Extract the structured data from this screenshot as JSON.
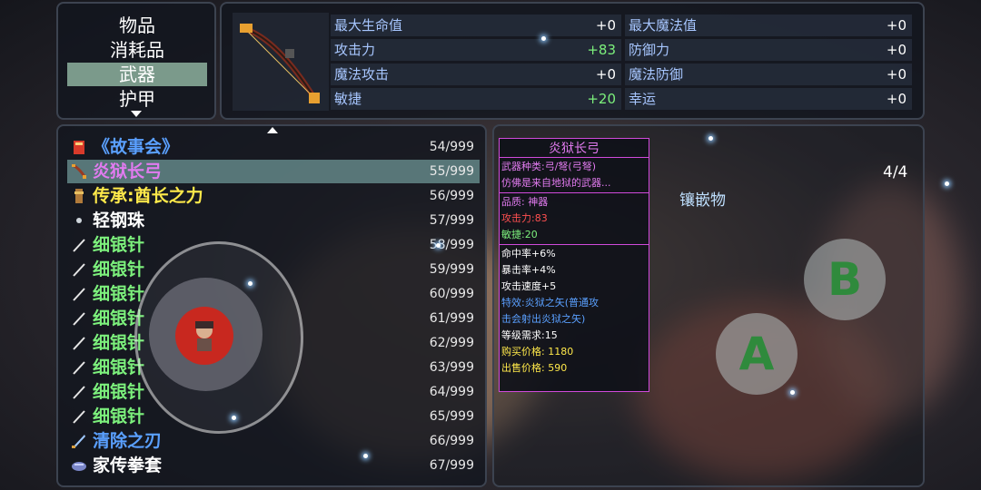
{
  "categories": {
    "items": [
      "物品",
      "消耗品",
      "武器",
      "护甲"
    ],
    "selected_index": 2
  },
  "stats": [
    {
      "label": "最大生命值",
      "value": "+0",
      "positive": false
    },
    {
      "label": "最大魔法值",
      "value": "+0",
      "positive": false
    },
    {
      "label": "攻击力",
      "value": "+83",
      "positive": true
    },
    {
      "label": "防御力",
      "value": "+0",
      "positive": false
    },
    {
      "label": "魔法攻击",
      "value": "+0",
      "positive": false
    },
    {
      "label": "魔法防御",
      "value": "+0",
      "positive": false
    },
    {
      "label": "敏捷",
      "value": "+20",
      "positive": true
    },
    {
      "label": "幸运",
      "value": "+0",
      "positive": false
    }
  ],
  "items": [
    {
      "name": "《故事会》",
      "count": "54/999",
      "color": "#5aa0ff",
      "icon": "book-icon"
    },
    {
      "name": "炎狱长弓",
      "count": "55/999",
      "color": "#e27bf0",
      "icon": "bow-icon",
      "selected": true
    },
    {
      "name": "传承:酋长之力",
      "count": "56/999",
      "color": "#ffe94a",
      "icon": "totem-icon"
    },
    {
      "name": "轻钢珠",
      "count": "57/999",
      "color": "#ffffff",
      "icon": "ball-icon"
    },
    {
      "name": "细银针",
      "count": "58/999",
      "color": "#7cf07c",
      "icon": "needle-icon"
    },
    {
      "name": "细银针",
      "count": "59/999",
      "color": "#7cf07c",
      "icon": "needle-icon"
    },
    {
      "name": "细银针",
      "count": "60/999",
      "color": "#7cf07c",
      "icon": "needle-icon"
    },
    {
      "name": "细银针",
      "count": "61/999",
      "color": "#7cf07c",
      "icon": "needle-icon"
    },
    {
      "name": "细银针",
      "count": "62/999",
      "color": "#7cf07c",
      "icon": "needle-icon"
    },
    {
      "name": "细银针",
      "count": "63/999",
      "color": "#7cf07c",
      "icon": "needle-icon"
    },
    {
      "name": "细银针",
      "count": "64/999",
      "color": "#7cf07c",
      "icon": "needle-icon"
    },
    {
      "name": "细银针",
      "count": "65/999",
      "color": "#7cf07c",
      "icon": "needle-icon"
    },
    {
      "name": "清除之刃",
      "count": "66/999",
      "color": "#5aa0ff",
      "icon": "blade-icon"
    },
    {
      "name": "家传拳套",
      "count": "67/999",
      "color": "#ffffff",
      "icon": "gauntlet-icon"
    }
  ],
  "detail": {
    "title": "炎狱长弓",
    "lines": [
      {
        "text": "武器种类:弓/弩(弓弩)",
        "color": "#e27bf0"
      },
      {
        "text": "仿佛是来自地狱的武器...",
        "color": "#e27bf0"
      },
      {
        "sep": true
      },
      {
        "text": "品质: 神器",
        "color": "#e27bf0"
      },
      {
        "text": "攻击力:83",
        "color": "#ff5050"
      },
      {
        "text": "敏捷:20",
        "color": "#7cf07c"
      },
      {
        "sep": true
      },
      {
        "text": "命中率+6%",
        "color": "#ffffff"
      },
      {
        "text": "暴击率+4%",
        "color": "#ffffff"
      },
      {
        "text": "攻击速度+5",
        "color": "#ffffff"
      },
      {
        "text": "特效:炎狱之矢(普通攻",
        "color": "#5aa0ff"
      },
      {
        "text": "击会射出炎狱之矢)",
        "color": "#5aa0ff"
      },
      {
        "text": "等级需求:15",
        "color": "#ffffff"
      },
      {
        "text": "购买价格: 1180",
        "color": "#ffe94a"
      },
      {
        "text": "出售价格: 590",
        "color": "#ffe94a"
      }
    ]
  },
  "page_counter": "4/4",
  "gem_label": "镶嵌物",
  "buttons": {
    "a": "A",
    "b": "B"
  },
  "colors": {
    "accent_selected": "#7b9a8b",
    "detail_border": "#d04adb"
  }
}
